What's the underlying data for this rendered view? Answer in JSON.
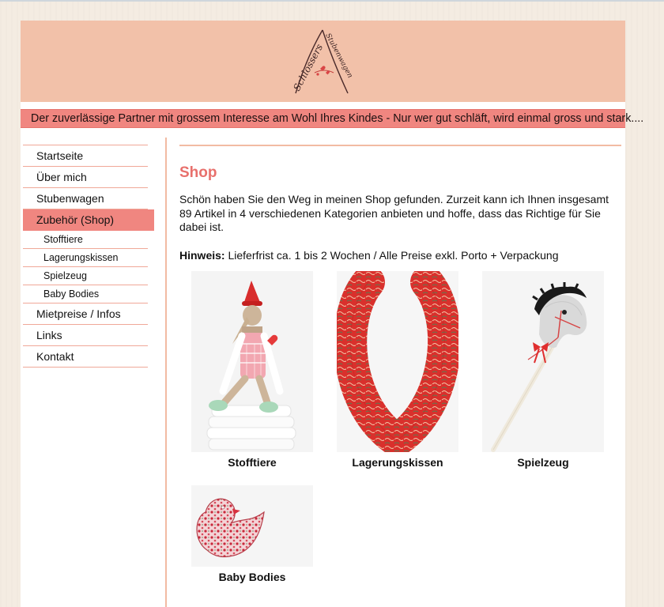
{
  "header": {
    "logo_alt": "Schlossers Stubenwagen"
  },
  "slogan": "Der zuverlässige Partner mit grossem Interesse am Wohl Ihres Kindes - Nur wer gut schläft, wird einmal gross und stark....",
  "sidebar": {
    "items": [
      {
        "label": "Startseite"
      },
      {
        "label": "Über mich"
      },
      {
        "label": "Stubenwagen"
      },
      {
        "label": "Zubehör (Shop)",
        "active": true
      }
    ],
    "sub_items": [
      {
        "label": "Stofftiere"
      },
      {
        "label": "Lagerungskissen"
      },
      {
        "label": "Spielzeug"
      },
      {
        "label": "Baby Bodies"
      }
    ],
    "items_after": [
      {
        "label": "Mietpreise / Infos"
      },
      {
        "label": "Links"
      },
      {
        "label": "Kontakt"
      }
    ]
  },
  "main": {
    "title": "Shop",
    "intro": "Schön haben Sie den Weg in meinen Shop gefunden. Zurzeit kann ich Ihnen insgesamt 89 Artikel in 4 verschiedenen Kategorien anbieten und hoffe, dass das Richtige für Sie dabei ist.",
    "hint_label": "Hinweis:",
    "hint_text": " Lieferfrist ca. 1 bis 2 Wochen / Alle Preise exkl. Porto + Verpackung",
    "categories": [
      {
        "label": "Stofftiere",
        "image": "plush-doll-image"
      },
      {
        "label": "Lagerungskissen",
        "image": "positioning-pillow-image"
      },
      {
        "label": "Spielzeug",
        "image": "hobby-horse-image"
      },
      {
        "label": "Baby Bodies",
        "image": "duck-bodysuit-image"
      }
    ]
  },
  "colors": {
    "header_bg": "#f2c1a9",
    "accent": "#f08680",
    "title": "#e8706c",
    "rule": "#f0a898"
  }
}
